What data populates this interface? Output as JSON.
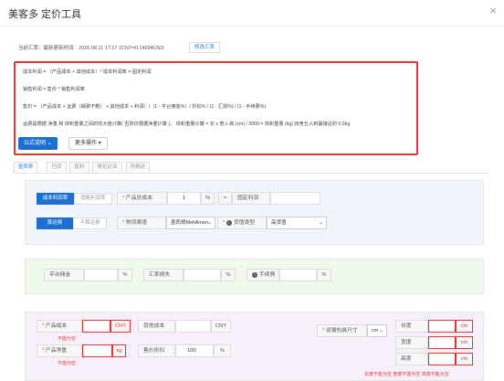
{
  "window": {
    "title": "美客多 定价工具",
    "close_symbol": "×"
  },
  "rate": {
    "text": "当前汇率：最新更新时间：2026.08.11 17:17 1CNY=0.14094USD",
    "update_button": "修改汇率"
  },
  "formulas": {
    "line1": "成本利润 = （产品成本 + 其他成本）* 成本利润率 = 固定利润",
    "line2": "销售利润 = 售价 * 销售利润率",
    "line3": "售价 = （产品成本 + 运费（邮费不敷） + 其他成本 + 利润）/（1 - 平台佣金%）/ 折扣% / (1 - 汇损%) / (1 - 手续费%)",
    "line4": "运费是根据 净重 和 体积重量之间的较大值计算( 否则仅根据净重计算 )。 体积重量计算 = 长 x 宽 x 高 (cm) / 5000 = 体积重量 (kg) 四舍五入到最接近的 0.5kg",
    "explain_button": "公式说明",
    "more_button": "更多操作"
  },
  "tabs": [
    "墨西哥",
    "巴西",
    "智利",
    "哥伦比亚",
    "阿根廷"
  ],
  "profit_mode": {
    "on": "成本利润率",
    "off": "销售利润率"
  },
  "cost_total": {
    "label": "产品总成本",
    "value": "1",
    "unit": "%",
    "sep": "=",
    "fixed_label": "固定利润"
  },
  "shipping_mode": {
    "on": "算运费",
    "off": "不算运费"
  },
  "channel": {
    "label": "物流渠道",
    "value": "墨西哥MeliAmeri"
  },
  "goods_type": {
    "label": "货值类型",
    "value": "高货值"
  },
  "fees": {
    "platform_label": "平台佣金",
    "platform_unit": "%",
    "fx_loss_label": "汇率损失",
    "fx_loss_unit": "%",
    "service_label": "手续费",
    "service_unit": "%"
  },
  "product": {
    "cost_label": "产品成本",
    "cost_unit": "CNY",
    "cost_error": "不能为空",
    "other_label": "其他成本",
    "other_unit": "CNY",
    "weight_label": "产品净重",
    "weight_unit": "kg",
    "weight_error": "不能为空",
    "discount_label": "售价折扣",
    "discount_value": "100",
    "discount_unit": "%"
  },
  "package": {
    "label": "运输包装尺寸",
    "unit_select": "cm",
    "length_label": "长度",
    "width_label": "宽度",
    "height_label": "高度",
    "dim_unit": "cm",
    "errors": "长度不能为空  宽度不能为空  高度不能为空"
  }
}
